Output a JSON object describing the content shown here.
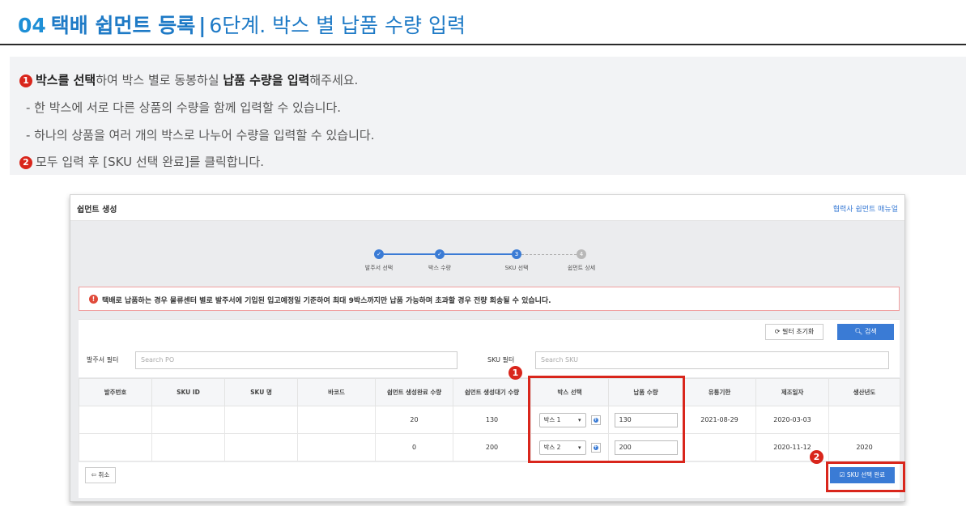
{
  "header": {
    "step_num": "04",
    "main_title": "택배 쉽먼트 등록",
    "separator": "|",
    "sub_title": "6단계. 박스 별 납품 수량 입력"
  },
  "instructions": {
    "badge1": "1",
    "line1_b1": "박스를 선택",
    "line1_t1": "하여 박스 별로 동봉하실 ",
    "line1_b2": "납품 수량을 입력",
    "line1_t2": "해주세요.",
    "line2": "- 한 박스에 서로 다른 상품의 수량을 함께 입력할 수 있습니다.",
    "line3": "- 하나의 상품을 여러 개의 박스로 나누어 수량을 입력할 수 있습니다.",
    "badge2": "2",
    "line4": "모두 입력 후 [SKU 선택 완료]를 클릭합니다."
  },
  "app": {
    "title": "쉽먼트 생성",
    "manual_link": "협력사 쉽먼트 매뉴얼",
    "steps": [
      {
        "label": "발주서 선택",
        "icon": "check-icon",
        "glyph": "✓"
      },
      {
        "label": "박스 수량",
        "icon": "check-icon",
        "glyph": "✓"
      },
      {
        "label": "SKU 선택",
        "icon": "",
        "glyph": "3"
      },
      {
        "label": "쉽먼트 상세",
        "icon": "",
        "glyph": "4"
      }
    ],
    "alert_text": "택배로 납품하는 경우 물류센터 별로 발주서에 기입된 입고예정일 기준하여 최대 9박스까지만 납품 가능하며 초과할 경우 전량 회송될 수 있습니다.",
    "reset_label": "필터 초기화",
    "search_label": "검색",
    "po_filter_label": "발주서 필터",
    "po_filter_placeholder": "Search PO",
    "sku_filter_label": "SKU 필터",
    "sku_filter_placeholder": "Search SKU",
    "columns": [
      "발주번호",
      "SKU ID",
      "SKU 명",
      "바코드",
      "쉽먼트 생성완료 수량",
      "쉽먼트 생성대기 수량",
      "박스 선택",
      "납품 수량",
      "유통기한",
      "제조일자",
      "생산년도"
    ],
    "rows": [
      {
        "po": "",
        "sku_id": "",
        "sku_name": "",
        "barcode": "",
        "done_qty": "20",
        "wait_qty": "130",
        "box": "박스 1",
        "deliver_qty": "130",
        "expiry": "2021-08-29",
        "mfg_date": "2020-03-03",
        "year": ""
      },
      {
        "po": "",
        "sku_id": "",
        "sku_name": "",
        "barcode": "",
        "done_qty": "0",
        "wait_qty": "200",
        "box": "박스 2",
        "deliver_qty": "200",
        "expiry": "",
        "mfg_date": "2020-11-12",
        "year": "2020"
      }
    ],
    "cancel_label": "취소",
    "complete_label": "SKU 선택 완료"
  },
  "annotations": {
    "badge1": "1",
    "badge2": "2",
    "color": "#d9261c"
  },
  "colors": {
    "accent": "#3a7bd5",
    "title_blue": "#1e7ac6",
    "alert_red": "#e04a3a"
  }
}
